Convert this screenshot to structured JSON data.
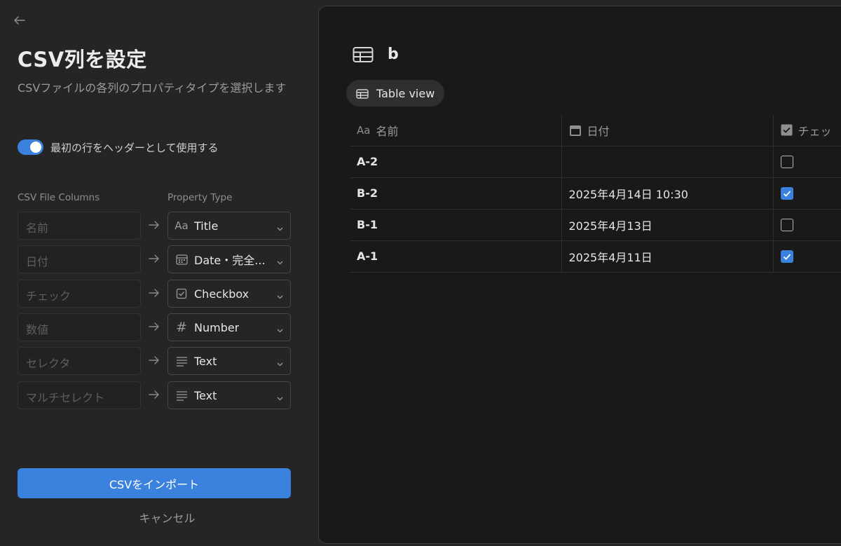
{
  "left": {
    "title": "CSV列を設定",
    "subtitle": "CSVファイルの各列のプロパティタイプを選択します",
    "header_toggle": {
      "label": "最初の行をヘッダーとして使用する",
      "on": true
    },
    "col_head_csv": "CSV File Columns",
    "col_head_type": "Property Type",
    "mappings": [
      {
        "column": "名前",
        "type": "Title",
        "icon": "text-aa-icon"
      },
      {
        "column": "日付",
        "type": "Date・完全...",
        "icon": "calendar-icon"
      },
      {
        "column": "チェック",
        "type": "Checkbox",
        "icon": "checkbox-icon"
      },
      {
        "column": "数値",
        "type": "Number",
        "icon": "hash-icon"
      },
      {
        "column": "セレクタ",
        "type": "Text",
        "icon": "lines-icon"
      },
      {
        "column": "マルチセレクト",
        "type": "Text",
        "icon": "lines-icon"
      }
    ],
    "import_label": "CSVをインポート",
    "cancel_label": "キャンセル"
  },
  "preview": {
    "db_name": "b",
    "view_label": "Table view",
    "columns": [
      "名前",
      "日付",
      "チェッ"
    ],
    "rows": [
      {
        "name": "A-2",
        "date": "",
        "checked": false
      },
      {
        "name": "B-2",
        "date": "2025年4月14日 10:30",
        "checked": true
      },
      {
        "name": "B-1",
        "date": "2025年4月13日",
        "checked": false
      },
      {
        "name": "A-1",
        "date": "2025年4月11日",
        "checked": true
      }
    ]
  },
  "colors": {
    "accent": "#3a82dd",
    "panel": "#191919",
    "background": "#252525"
  }
}
